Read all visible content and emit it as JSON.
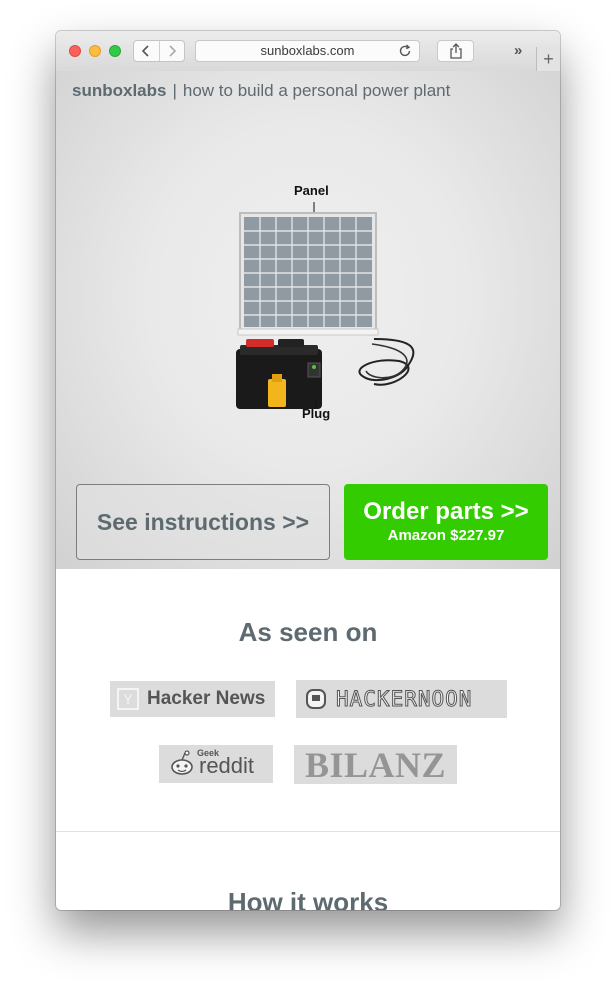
{
  "browser": {
    "url": "sunboxlabs.com",
    "overflow_label": "»",
    "new_tab_label": "+"
  },
  "header": {
    "brand": "sunboxlabs",
    "separator": "|",
    "tagline": "how to build a personal power plant"
  },
  "hero": {
    "panel_label": "Panel",
    "plug_label": "Plug",
    "instructions_button": "See instructions >>",
    "order_button": "Order parts >>",
    "order_price": "Amazon $227.97"
  },
  "as_seen_on": {
    "title": "As seen on",
    "logos": [
      {
        "name": "Hacker News",
        "text": "Hacker News",
        "mark": "Y"
      },
      {
        "name": "Hackernoon",
        "text": "HACKERNOON"
      },
      {
        "name": "reddit",
        "small": "Geek",
        "text": "reddit"
      },
      {
        "name": "Bilanz",
        "text": "BILANZ"
      }
    ]
  },
  "how_it_works": {
    "title": "How it works"
  },
  "colors": {
    "accent_green": "#33cc00",
    "heading_gray": "#5d6a70"
  }
}
